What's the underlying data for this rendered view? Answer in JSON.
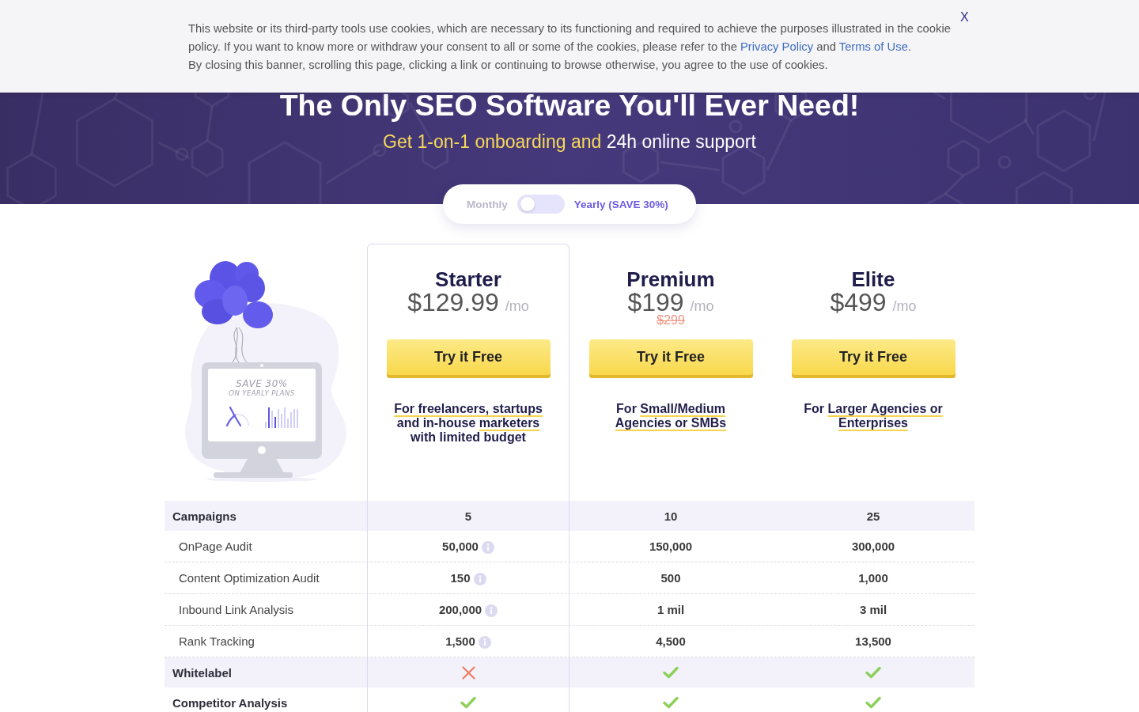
{
  "cookie_banner": {
    "paragraphs": [
      {
        "parts": [
          {
            "kind": "text",
            "text": "This website or its third-party tools use cookies, which are necessary to its functioning and required to achieve the purposes illustrated in the cookie policy. If you want to know more or withdraw your consent to all or some of the cookies, please refer to the "
          },
          {
            "kind": "link",
            "text": "Privacy Policy"
          },
          {
            "kind": "text",
            "text": " and "
          },
          {
            "kind": "link",
            "text": "Terms of Use"
          },
          {
            "kind": "text",
            "text": "."
          }
        ]
      },
      {
        "parts": [
          {
            "kind": "text",
            "text": "By closing this banner, scrolling this page, clicking a link or continuing to browse otherwise, you agree to the use of cookies."
          }
        ]
      }
    ],
    "close": "X"
  },
  "hero": {
    "title": "The Only SEO Software You'll Ever Need!",
    "subtitle": [
      {
        "text": "Get 1-on-1 onboarding and ",
        "highlighted": true
      },
      {
        "text": "24h online support",
        "highlighted": false
      }
    ]
  },
  "billing_toggle": {
    "options": [
      {
        "label": "Monthly",
        "selected": false
      },
      {
        "label": "Yearly (SAVE 30%)",
        "selected": true
      }
    ],
    "on": false
  },
  "illustration": {
    "screen_text": [
      "SAVE 30%",
      "ON YEARLY PLANS"
    ]
  },
  "plans": [
    {
      "name": "Starter",
      "price": "$129.99",
      "period": "/mo",
      "selected": true,
      "button": "Try it Free",
      "description": [
        [
          {
            "text": "For freelancers, startups",
            "underlined": true
          }
        ],
        [
          {
            "text": "and in-house ",
            "underlined": false
          },
          {
            "text": "marketers",
            "underlined": true
          }
        ],
        [
          {
            "text": "with limited budget",
            "underlined": false
          }
        ]
      ]
    },
    {
      "name": "Premium",
      "price": "$199",
      "period": "/mo",
      "old_price": "$299",
      "selected": false,
      "button": "Try it Free",
      "description": [
        [
          {
            "text": "For ",
            "underlined": false
          },
          {
            "text": "Small/Medium",
            "underlined": true
          }
        ],
        [
          {
            "text": "Agencies or SMBs",
            "underlined": true
          }
        ]
      ]
    },
    {
      "name": "Elite",
      "price": "$499",
      "period": "/mo",
      "selected": false,
      "button": "Try it Free",
      "description": [
        [
          {
            "text": "For ",
            "underlined": false
          },
          {
            "text": "Larger Agencies or",
            "underlined": true
          }
        ],
        [
          {
            "text": "Enterprises",
            "underlined": true
          }
        ]
      ]
    }
  ],
  "features": {
    "rows": [
      {
        "label": "Campaigns",
        "kind": "group",
        "shaded": true,
        "cells": [
          {
            "kind": "value",
            "text": "5",
            "info": false
          },
          {
            "kind": "value",
            "text": "10",
            "info": false
          },
          {
            "kind": "value",
            "text": "25",
            "info": false
          }
        ]
      },
      {
        "label": "OnPage Audit",
        "kind": "feature",
        "shaded": false,
        "cells": [
          {
            "kind": "value",
            "text": "50,000",
            "info": true
          },
          {
            "kind": "value",
            "text": "150,000",
            "info": false
          },
          {
            "kind": "value",
            "text": "300,000",
            "info": false
          }
        ]
      },
      {
        "label": "Content Optimization Audit",
        "kind": "feature",
        "shaded": false,
        "cells": [
          {
            "kind": "value",
            "text": "150",
            "info": true
          },
          {
            "kind": "value",
            "text": "500",
            "info": false
          },
          {
            "kind": "value",
            "text": "1,000",
            "info": false
          }
        ]
      },
      {
        "label": "Inbound Link Analysis",
        "kind": "feature",
        "shaded": false,
        "cells": [
          {
            "kind": "value",
            "text": "200,000",
            "info": true
          },
          {
            "kind": "value",
            "text": "1 mil",
            "info": false
          },
          {
            "kind": "value",
            "text": "3 mil",
            "info": false
          }
        ]
      },
      {
        "label": "Rank Tracking",
        "kind": "feature",
        "shaded": false,
        "cells": [
          {
            "kind": "value",
            "text": "1,500",
            "info": true
          },
          {
            "kind": "value",
            "text": "4,500",
            "info": false
          },
          {
            "kind": "value",
            "text": "13,500",
            "info": false
          }
        ]
      },
      {
        "label": "Whitelabel",
        "kind": "group",
        "shaded": true,
        "cells": [
          {
            "kind": "mark",
            "included": false
          },
          {
            "kind": "mark",
            "included": true
          },
          {
            "kind": "mark",
            "included": true
          }
        ]
      },
      {
        "label": "Competitor Analysis",
        "kind": "group",
        "shaded": false,
        "cells": [
          {
            "kind": "mark",
            "included": true
          },
          {
            "kind": "mark",
            "included": true
          },
          {
            "kind": "mark",
            "included": true
          }
        ]
      }
    ]
  }
}
